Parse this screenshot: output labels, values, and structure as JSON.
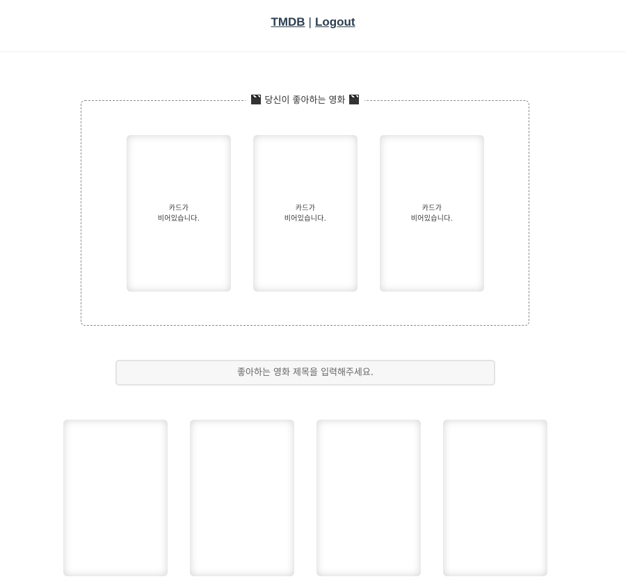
{
  "nav": {
    "home_label": "TMDB",
    "separator": "|",
    "logout_label": "Logout"
  },
  "favorites": {
    "title": "당신이 좋아하는 영화",
    "title_icon": "clapperboard-icon",
    "cards": [
      {
        "empty_text": "카드가\n비어있습니다."
      },
      {
        "empty_text": "카드가\n비어있습니다."
      },
      {
        "empty_text": "카드가\n비어있습니다."
      }
    ]
  },
  "search": {
    "placeholder": "좋아하는 영화 제목을 입력해주세요.",
    "value": ""
  },
  "results": {
    "count": 4
  }
}
